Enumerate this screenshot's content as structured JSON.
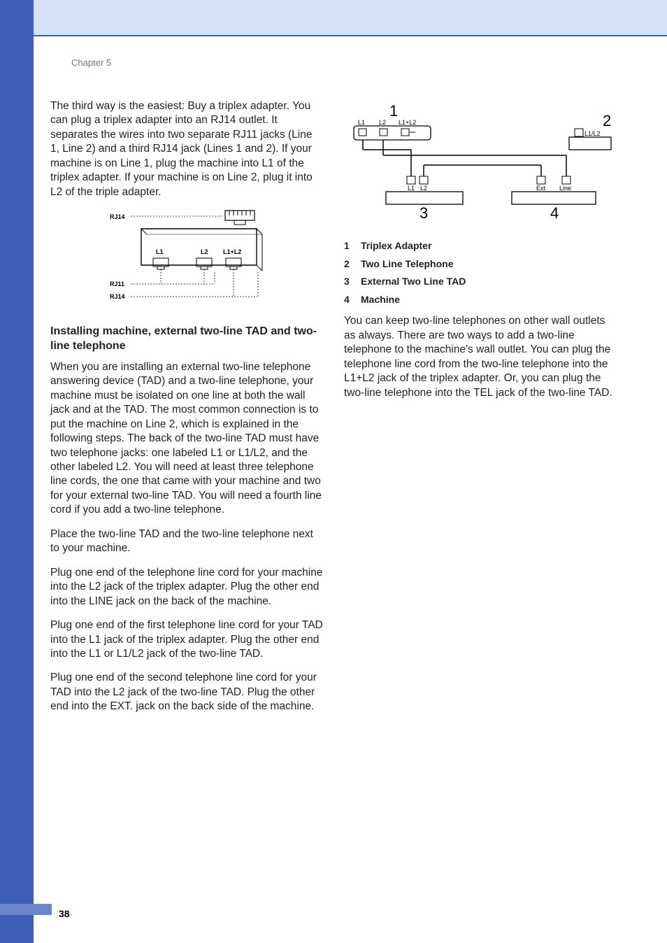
{
  "chapter": "Chapter 5",
  "page_number": "38",
  "col1": {
    "p1": "The third way is the easiest: Buy a triplex adapter. You can plug a triplex adapter into an RJ14 outlet. It separates the wires into two separate RJ11 jacks (Line 1, Line 2) and a third RJ14 jack (Lines 1 and 2). If your machine is on Line 1, plug the machine into L1 of the triplex adapter. If your machine is on Line 2, plug it into L2 of the triple adapter.",
    "subhead": "Installing machine, external two-line TAD and two-line telephone",
    "p2": "When you are installing an external two-line telephone answering device (TAD) and a two-line telephone, your machine must be isolated on one line at both the wall jack and at the TAD. The most common connection is to put the machine on Line 2, which is explained in the following steps. The back of the two-line TAD must have two telephone jacks: one labeled L1 or L1/L2, and the other labeled L2. You will need at least three telephone line cords, the one that came with your machine and two for your external two-line TAD. You will need a fourth line cord if you add a two-line telephone.",
    "p3": "Place the two-line TAD and the two-line telephone next to your machine.",
    "p4": "Plug one end of the telephone line cord for your machine into the L2 jack of the triplex adapter. Plug the other end into the LINE jack on the back of the machine.",
    "p5": "Plug one end of the first telephone line cord for your TAD into the L1 jack of the triplex adapter. Plug the other end into the L1 or L1/L2 jack of the two-line TAD.",
    "p6": "Plug one end of the second telephone line cord for your TAD into the L2 jack of the two-line TAD. Plug the other end into the EXT. jack on the back side of the machine."
  },
  "figure1": {
    "rj14a": "RJ14",
    "rj11": "RJ11",
    "rj14b": "RJ14",
    "l1": "L1",
    "l2": "L2",
    "l1l2": "L1+L2"
  },
  "figure2": {
    "n1": "1",
    "n2": "2",
    "n3": "3",
    "n4": "4",
    "l1": "L1",
    "l2": "L2",
    "l1l2top": "L1+L2",
    "l1l2right": "L1/L2",
    "l1b": "L1",
    "l2b": "L2",
    "ext": "Ext",
    "line": "Line"
  },
  "legend": {
    "n1": "1",
    "t1": "Triplex Adapter",
    "n2": "2",
    "t2": "Two Line Telephone",
    "n3": "3",
    "t3": "External Two Line TAD",
    "n4": "4",
    "t4": "Machine"
  },
  "col2": {
    "p1": "You can keep two-line telephones on other wall outlets as always. There are two ways to add a two-line telephone to the machine's wall outlet. You can plug the telephone line cord from the two-line telephone into the L1+L2 jack of the triplex adapter. Or, you can plug the two-line telephone into the TEL jack of the two-line TAD."
  }
}
